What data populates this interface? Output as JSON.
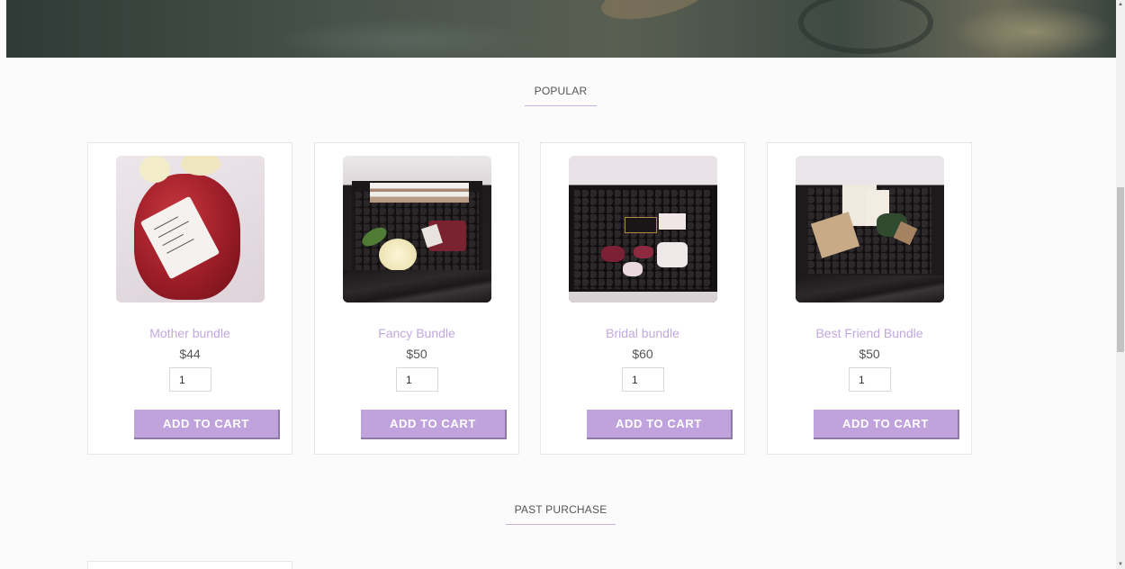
{
  "sections": {
    "popular_title": "POPULAR",
    "past_purchase_title": "PAST PURCHASE"
  },
  "products": [
    {
      "name": "Mother bundle",
      "price": "$44",
      "quantity": "1",
      "button_label": "ADD TO CART"
    },
    {
      "name": "Fancy Bundle",
      "price": "$50",
      "quantity": "1",
      "button_label": "ADD TO CART"
    },
    {
      "name": "Bridal bundle",
      "price": "$60",
      "quantity": "1",
      "button_label": "ADD TO CART"
    },
    {
      "name": "Best Friend Bundle",
      "price": "$50",
      "quantity": "1",
      "button_label": "ADD TO CART"
    }
  ],
  "icons": {
    "scroll_up": "scroll-up-arrow-icon",
    "scroll_down": "scroll-down-arrow-icon"
  },
  "colors": {
    "accent": "#c0a3dc",
    "product_name": "#c3a8df",
    "underline": "#c7b3dc"
  }
}
